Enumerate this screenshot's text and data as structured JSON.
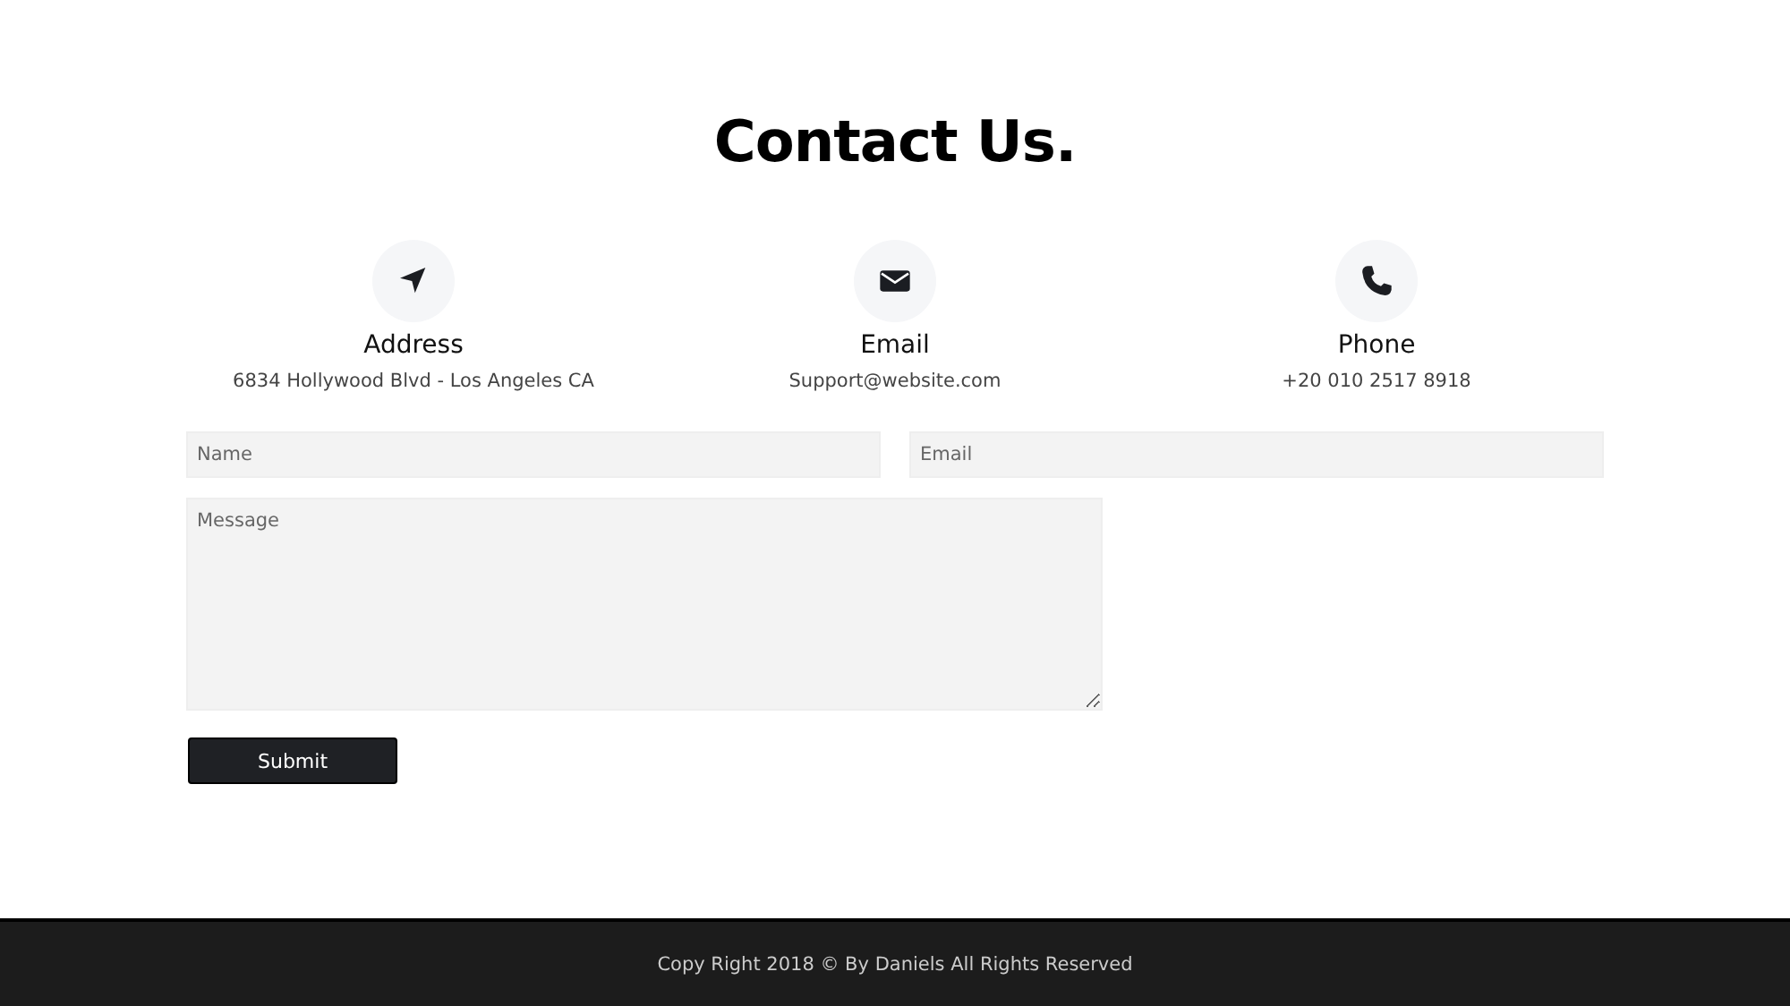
{
  "heading": "Contact Us.",
  "contacts": [
    {
      "kind": "location",
      "label": "Address",
      "value": "6834 Hollywood Blvd - Los Angeles CA"
    },
    {
      "kind": "mail",
      "label": "Email",
      "value": "Support@website.com"
    },
    {
      "kind": "phone",
      "label": "Phone",
      "value": "+20 010 2517 8918"
    }
  ],
  "form": {
    "name": {
      "placeholder": "Name"
    },
    "email": {
      "placeholder": "Email"
    },
    "message": {
      "placeholder": "Message"
    },
    "submit": "Submit"
  },
  "footer": "Copy Right 2018 © By Daniels All Rights Reserved"
}
